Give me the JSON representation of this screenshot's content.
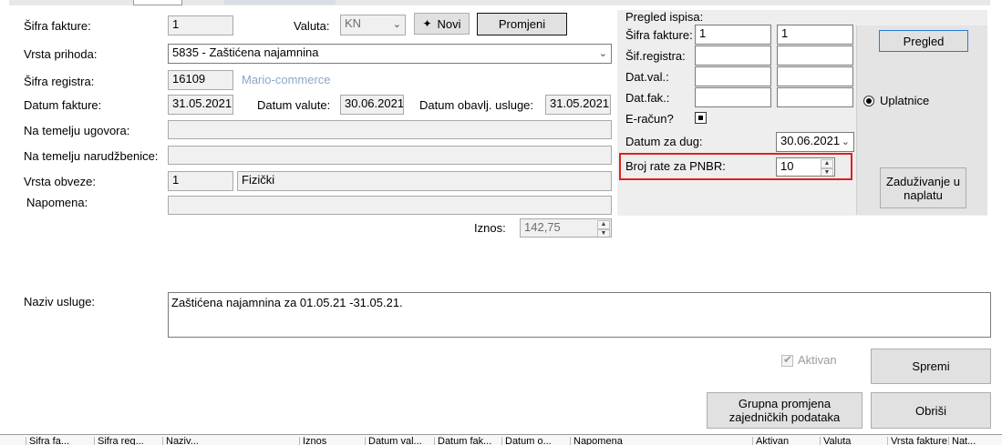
{
  "form": {
    "sifra_fakture_label": "Šifra fakture:",
    "sifra_fakture_value": "1",
    "valuta_label": "Valuta:",
    "valuta_value": "KN",
    "novi_label": "Novi",
    "promjeni_label": "Promjeni",
    "vrsta_prihoda_label": "Vrsta prihoda:",
    "vrsta_prihoda_value": "5835 - Zaštićena najamnina",
    "sifra_registra_label": "Šifra registra:",
    "sifra_registra_value": "16109",
    "registra_name": "Mario-commerce",
    "datum_fakture_label": "Datum fakture:",
    "datum_fakture_value": "31.05.2021",
    "datum_valute_label": "Datum valute:",
    "datum_valute_value": "30.06.2021",
    "datum_obavlj_label": "Datum obavlj. usluge:",
    "datum_obavlj_value": "31.05.2021",
    "ugovor_label": "Na temelju ugovora:",
    "narudzbenica_label": "Na temelju narudžbenice:",
    "vrsta_obveze_label": "Vrsta obveze:",
    "vrsta_obveze_code": "1",
    "vrsta_obveze_name": "Fizički",
    "napomena_label": "Napomena:",
    "iznos_label": "Iznos:",
    "iznos_value": "142,75",
    "naziv_usluge_label": "Naziv usluge:",
    "naziv_usluge_value": "Zaštićena najamnina za 01.05.21 -31.05.21."
  },
  "pregled": {
    "title": "Pregled ispisa:",
    "sifra_fakture_label": "Šifra fakture:",
    "sifra_fakture_from": "1",
    "sifra_fakture_to": "1",
    "sif_registra_label": "Šif.registra:",
    "dat_val_label": "Dat.val.:",
    "dat_fak_label": "Dat.fak.:",
    "e_racun_label": "E-račun?",
    "datum_za_dug_label": "Datum za dug:",
    "datum_za_dug_value": "30.06.2021",
    "broj_rate_label": "Broj rate za PNBR:",
    "broj_rate_value": "10",
    "pregled_button": "Pregled",
    "uplatnice_label": "Uplatnice",
    "zaduzivanje_button": "Zaduživanje u naplatu"
  },
  "actions": {
    "aktivan_label": "Aktivan",
    "spremi_label": "Spremi",
    "grupna_label": "Grupna promjena zajedničkih podataka",
    "obrisi_label": "Obriši"
  },
  "grid": {
    "headers": [
      "Šifra fa...",
      "Šifra reg...",
      "Naziv...",
      "Iznos",
      "Datum val...",
      "Datum fak...",
      "Datum o...",
      "Napomena",
      "Aktivan",
      "Valuta",
      "Vrsta fakture",
      "Nat..."
    ]
  },
  "colors": {
    "highlight": "#e0201c",
    "panel": "#eeeeee",
    "link_gray": "#8aa7c6"
  }
}
